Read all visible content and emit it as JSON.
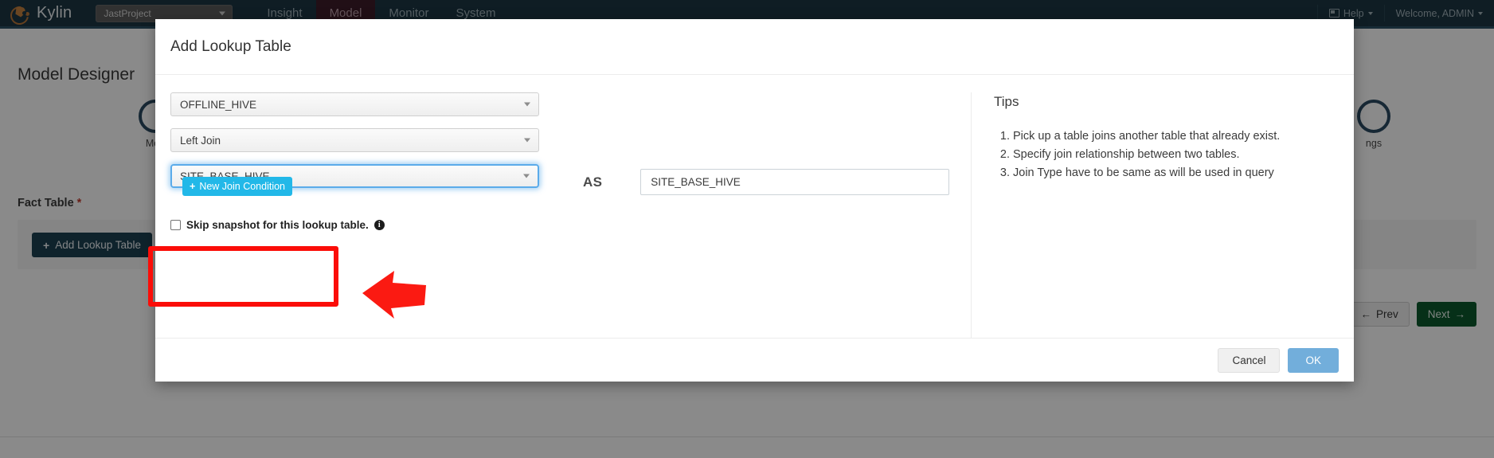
{
  "navbar": {
    "brand": "Kylin",
    "project_selector": {
      "value": "JastProject",
      "icon": "chevron-down-icon"
    },
    "items": [
      {
        "label": "Insight",
        "active": false
      },
      {
        "label": "Model",
        "active": true
      },
      {
        "label": "Monitor",
        "active": false
      },
      {
        "label": "System",
        "active": false
      }
    ],
    "help": {
      "label": "Help",
      "icon": "book-icon",
      "caret": "chevron-down-icon"
    },
    "user": {
      "label": "Welcome, ADMIN",
      "caret": "chevron-down-icon"
    }
  },
  "page": {
    "title": "Model Designer",
    "steps": [
      {
        "label": "Mod",
        "name": "model-info-step"
      },
      {
        "label": "ngs",
        "name": "settings-step"
      }
    ],
    "fact_table_label": "Fact Table",
    "required_mark": "*",
    "add_lookup_table_button": "Add Lookup Table",
    "add_lookup_plus": "+",
    "prev_button": "Prev",
    "prev_arrow": "←",
    "next_button": "Next",
    "next_arrow": "→"
  },
  "modal": {
    "title": "Add Lookup Table",
    "data_source_select": {
      "value": "OFFLINE_HIVE",
      "icon": "chevron-down-icon"
    },
    "join_type_select": {
      "value": "Left Join",
      "icon": "chevron-down-icon"
    },
    "lookup_table_select": {
      "value": "SITE_BASE_HIVE",
      "icon": "chevron-down-icon",
      "focused": true
    },
    "as_label": "AS",
    "alias_input": {
      "value": "SITE_BASE_HIVE",
      "placeholder": ""
    },
    "skip_snapshot": {
      "label": "Skip snapshot for this lookup table.",
      "checked": false,
      "info_icon": "info-icon",
      "info_glyph": "i"
    },
    "new_join_condition_button": "New Join Condition",
    "new_join_plus": "+",
    "tips": {
      "title": "Tips",
      "items": [
        "Pick up a table joins another table that already exist.",
        "Specify join relationship between two tables.",
        "Join Type have to be same as will be used in query"
      ]
    },
    "cancel_button": "Cancel",
    "ok_button": "OK"
  },
  "annotations": {
    "highlight_box_color": "#fb0d08",
    "arrow_color": "#fb1a12"
  }
}
